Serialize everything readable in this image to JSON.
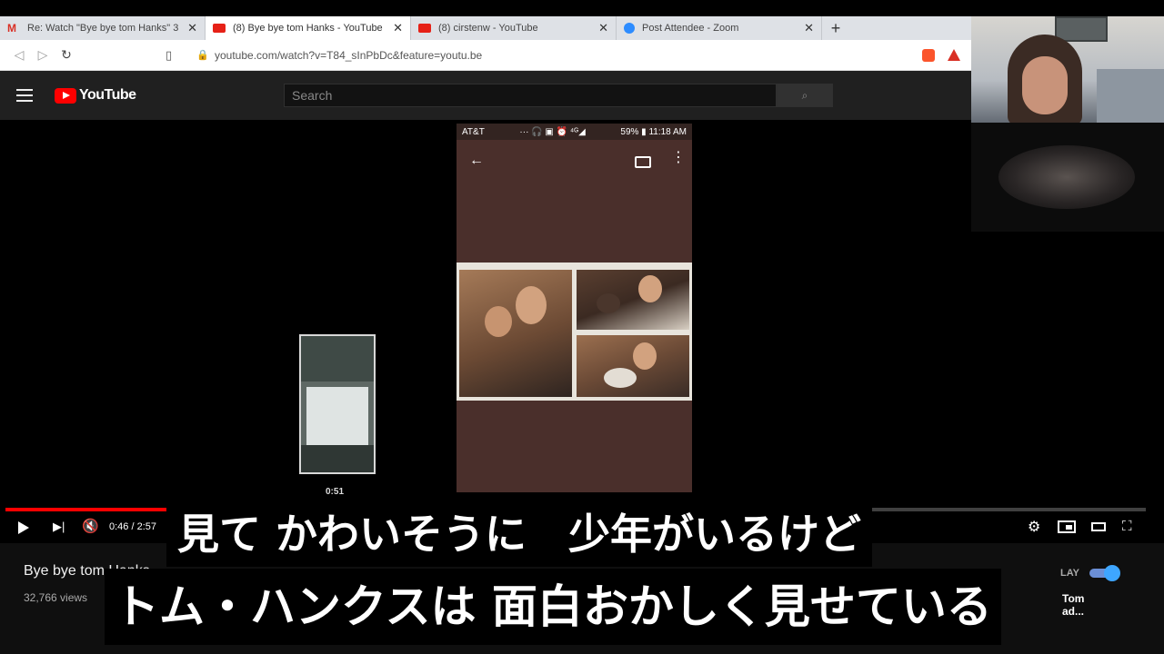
{
  "browser": {
    "tabs": [
      {
        "label": "Re: Watch \"Bye bye tom Hanks\" 3",
        "icon": "gmail-icon",
        "active": false
      },
      {
        "label": "(8) Bye bye tom Hanks - YouTube",
        "icon": "youtube-icon",
        "active": true
      },
      {
        "label": "(8) cirstenw - YouTube",
        "icon": "youtube-icon",
        "active": false
      },
      {
        "label": "Post Attendee - Zoom",
        "icon": "zoom-icon",
        "active": false
      }
    ],
    "tab_close": "✕",
    "new_tab": "+",
    "url": "youtube.com/watch?v=T84_sInPbDc&feature=youtu.be"
  },
  "youtube": {
    "logo_text": "YouTube",
    "search_placeholder": "Search",
    "player": {
      "progress": 0.15,
      "time": "0:46 / 2:57",
      "thumb_time": "0:51",
      "phone_status_left": "AT&T",
      "phone_status_right": "59% ▮ 11:18 AM",
      "phone_status_icons": "···  🎧 ▣ ⏰ ⁴ᴳ◢"
    },
    "video_title": "Bye bye tom Hanks",
    "views": "32,766 views",
    "autoplay_label": "LAY",
    "up_next": "Tom\nad..."
  },
  "subtitles": {
    "line1": "見て かわいそうに　少年がいるけど",
    "line2": "トム・ハンクスは 面白おかしく見せている"
  },
  "colors": {
    "youtube_red": "#ff0000",
    "header_bg": "#202020",
    "tabbar_bg": "#dee1e6"
  }
}
